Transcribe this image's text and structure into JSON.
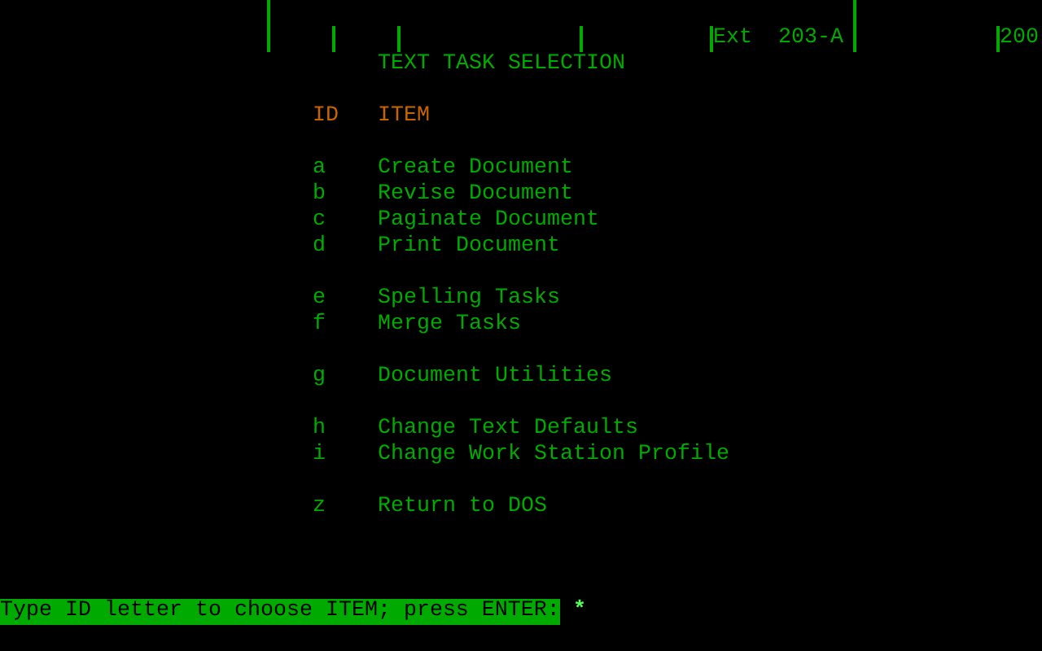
{
  "ruler": {
    "extension": "Ext  203-A",
    "field_2": "200"
  },
  "title": "TEXT TASK SELECTION",
  "columns": [
    "ID",
    "ITEM"
  ],
  "groups": [
    [
      {
        "id": "a",
        "item": "Create Document"
      },
      {
        "id": "b",
        "item": "Revise Document"
      },
      {
        "id": "c",
        "item": "Paginate Document"
      },
      {
        "id": "d",
        "item": "Print Document"
      }
    ],
    [
      {
        "id": "e",
        "item": "Spelling Tasks"
      },
      {
        "id": "f",
        "item": "Merge Tasks"
      }
    ],
    [
      {
        "id": "g",
        "item": "Document Utilities"
      }
    ],
    [
      {
        "id": "h",
        "item": "Change Text Defaults"
      },
      {
        "id": "i",
        "item": "Change Work Station Profile"
      }
    ],
    [
      {
        "id": "z",
        "item": "Return to DOS"
      }
    ]
  ],
  "prompt": "Type ID letter to choose ITEM; press ENTER:",
  "cursor": "*"
}
